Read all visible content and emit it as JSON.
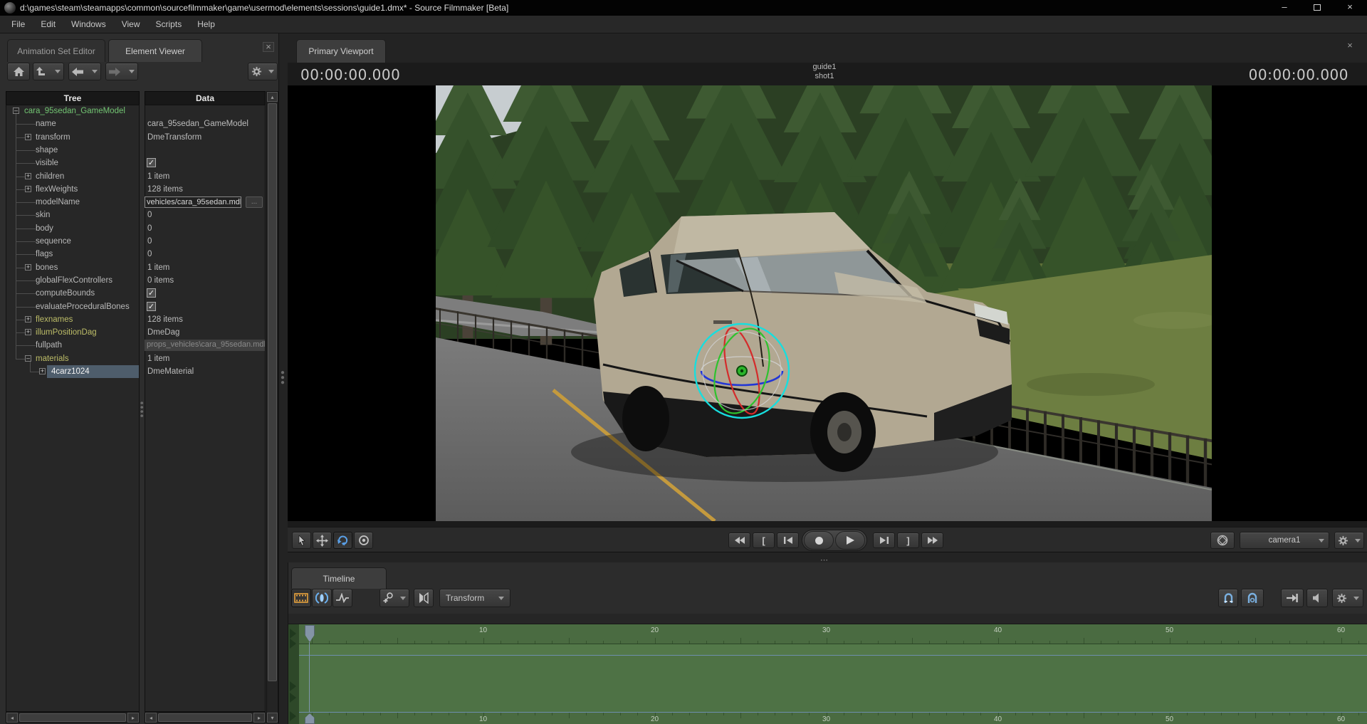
{
  "window": {
    "title": "d:\\games\\steam\\steamapps\\common\\sourcefilmmaker\\game\\usermod\\elements\\sessions\\guide1.dmx* - Source Filmmaker [Beta]",
    "minimize": "–",
    "close": "×"
  },
  "menu": {
    "items": [
      "File",
      "Edit",
      "Windows",
      "View",
      "Scripts",
      "Help"
    ]
  },
  "element_viewer": {
    "tabs": [
      {
        "label": "Animation Set Editor",
        "active": false
      },
      {
        "label": "Element Viewer",
        "active": true
      }
    ],
    "close": "×",
    "columns": {
      "tree": "Tree",
      "data": "Data"
    },
    "rows": [
      {
        "label": "cara_95sedan_GameModel",
        "depth": 0,
        "expander": "minus",
        "color": "green",
        "value": {
          "type": "none"
        }
      },
      {
        "label": "name",
        "depth": 1,
        "value": {
          "type": "text",
          "text": "cara_95sedan_GameModel"
        }
      },
      {
        "label": "transform",
        "depth": 1,
        "expander": "plus",
        "value": {
          "type": "text",
          "text": "DmeTransform"
        }
      },
      {
        "label": "shape",
        "depth": 1,
        "value": {
          "type": "none"
        }
      },
      {
        "label": "visible",
        "depth": 1,
        "value": {
          "type": "checkbox",
          "checked": true
        }
      },
      {
        "label": "children",
        "depth": 1,
        "expander": "plus",
        "value": {
          "type": "text",
          "text": "1 item"
        }
      },
      {
        "label": "flexWeights",
        "depth": 1,
        "expander": "plus",
        "value": {
          "type": "text",
          "text": "128 items"
        }
      },
      {
        "label": "modelName",
        "depth": 1,
        "value": {
          "type": "input",
          "text": "vehicles/cara_95sedan.mdl",
          "button": "..."
        }
      },
      {
        "label": "skin",
        "depth": 1,
        "value": {
          "type": "text",
          "text": "0"
        }
      },
      {
        "label": "body",
        "depth": 1,
        "value": {
          "type": "text",
          "text": "0"
        }
      },
      {
        "label": "sequence",
        "depth": 1,
        "value": {
          "type": "text",
          "text": "0"
        }
      },
      {
        "label": "flags",
        "depth": 1,
        "value": {
          "type": "text",
          "text": "0"
        }
      },
      {
        "label": "bones",
        "depth": 1,
        "expander": "plus",
        "value": {
          "type": "text",
          "text": "1 item"
        }
      },
      {
        "label": "globalFlexControllers",
        "depth": 1,
        "value": {
          "type": "text",
          "text": "0 items"
        }
      },
      {
        "label": "computeBounds",
        "depth": 1,
        "value": {
          "type": "checkbox",
          "checked": true
        }
      },
      {
        "label": "evaluateProceduralBones",
        "depth": 1,
        "value": {
          "type": "checkbox",
          "checked": true
        }
      },
      {
        "label": "flexnames",
        "depth": 1,
        "expander": "plus",
        "color": "olive",
        "value": {
          "type": "text",
          "text": "128 items"
        }
      },
      {
        "label": "illumPositionDag",
        "depth": 1,
        "expander": "plus",
        "color": "olive",
        "value": {
          "type": "text",
          "text": "DmeDag"
        }
      },
      {
        "label": "fullpath",
        "depth": 1,
        "value": {
          "type": "disabled",
          "text": "props_vehicles\\cara_95sedan.mdl"
        }
      },
      {
        "label": "materials",
        "depth": 1,
        "expander": "minus",
        "color": "olive",
        "value": {
          "type": "text",
          "text": "1 item"
        }
      },
      {
        "label": "4carz1024",
        "depth": 2,
        "expander": "plus",
        "selected": true,
        "value": {
          "type": "text",
          "text": "DmeMaterial"
        }
      }
    ]
  },
  "viewport": {
    "tab": "Primary Viewport",
    "close": "×",
    "timecode_left": "00:00:00.000",
    "timecode_right": "00:00:00.000",
    "clip_label": "guide1",
    "shot_label": "shot1",
    "camera": "camera1"
  },
  "timeline": {
    "tab": "Timeline",
    "transform": "Transform",
    "ruler_numbers": [
      10,
      20,
      30,
      40,
      50,
      60
    ]
  },
  "icons": {
    "browse": "...",
    "check": "✓",
    "splitter_dots": "⋯",
    "divider_dots": "⋮"
  },
  "colors": {
    "gizmo_x_red": "#d42b2b",
    "gizmo_y_green": "#2ec22e",
    "gizmo_z_blue": "#2236d6",
    "gizmo_outer_cyan": "#17dede",
    "timeline_green": "#4e7245",
    "selection_blue": "#4e5d6b",
    "tree_root_green": "#72c472",
    "tree_attr_olive": "#bdbd68",
    "film_orange": "#e8a33d",
    "motion_blue": "#6ab0f0",
    "magnet_blue": "#7ab0e0",
    "rotate_blue": "#5aa0e8"
  }
}
